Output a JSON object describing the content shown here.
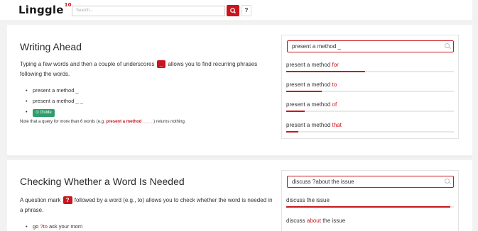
{
  "header": {
    "logo": "Linggle",
    "logo_sup": "10",
    "search_placeholder": "Search...",
    "help": "?"
  },
  "section1": {
    "title": "Writing Ahead",
    "p1_a": "Typing a few words and then a couple of underscores",
    "p1_box": "_",
    "p1_b": "allows you to find recurring phrases following the words.",
    "bullets": [
      "present a method _",
      "present a method",
      "_ _"
    ],
    "guide": "Guide",
    "note_a": "Note that a query for more than 6 words (e.g.",
    "note_b": "present a method _ _ _",
    "note_c": ") returns nothing.",
    "query": "present a method _",
    "results": [
      {
        "base": "present a method",
        "hl": "for",
        "pct": 0.47
      },
      {
        "base": "present a method",
        "hl": "to",
        "pct": 0.21
      },
      {
        "base": "present a method",
        "hl": "of",
        "pct": 0.11
      },
      {
        "base": "present a method",
        "hl": "that",
        "pct": 0.07
      }
    ]
  },
  "section2": {
    "title": "Checking Whether a Word Is Needed",
    "p_a": "A question mark",
    "p_box": "?",
    "p_b": "followed by a word (e.g., to) allows you to check whether the word is needed in a phrase.",
    "bullet_a": "go",
    "bullet_red": "?to",
    "bullet_b": "ask your mom",
    "query": "discuss ?about the issue",
    "r1": "discuss the issue",
    "r1_pct": 0.98,
    "r2_a": "discuss",
    "r2_hl": "about",
    "r2_b": "the issue"
  }
}
